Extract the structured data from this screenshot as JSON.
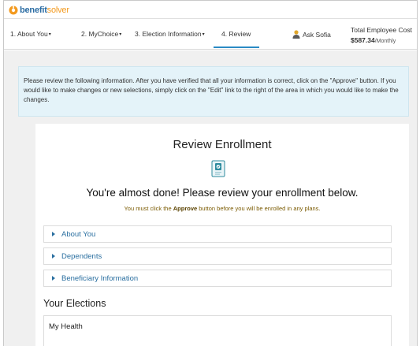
{
  "brand": {
    "name_a": "benefit",
    "name_b": "solver",
    "accent": "#2b6ca3",
    "accent2": "#f39a1f"
  },
  "nav": {
    "steps": [
      {
        "label": "1. About You",
        "caret": "▾"
      },
      {
        "label": "2. MyChoice",
        "caret": "▾"
      },
      {
        "label": "3. Election Information",
        "caret": "▾"
      },
      {
        "label": "4. Review",
        "caret": ""
      }
    ],
    "active_step": 3,
    "ask_label": "Ask Sofia",
    "cost_label": "Total Employee Cost",
    "cost_value": "$587.34",
    "cost_period": "/Monthly"
  },
  "notice": {
    "text": "Please review the following information. After you have verified that all your information is correct, click on the \"Approve\" button. If you would like to make changes or new selections, simply click on the \"Edit\" link to the right of the area in which you would like to make the changes."
  },
  "review": {
    "title": "Review Enrollment",
    "badge_icon": "clipboard-check-icon",
    "headline": "You're almost done! Please review your enrollment below.",
    "sub_before": "You must click the ",
    "sub_bold": "Approve",
    "sub_after": " button before you will be enrolled in any plans."
  },
  "sections": [
    {
      "label": "About You"
    },
    {
      "label": "Dependents"
    },
    {
      "label": "Beneficiary Information"
    }
  ],
  "elections": {
    "heading": "Your Elections",
    "first_plan": "My Health"
  }
}
